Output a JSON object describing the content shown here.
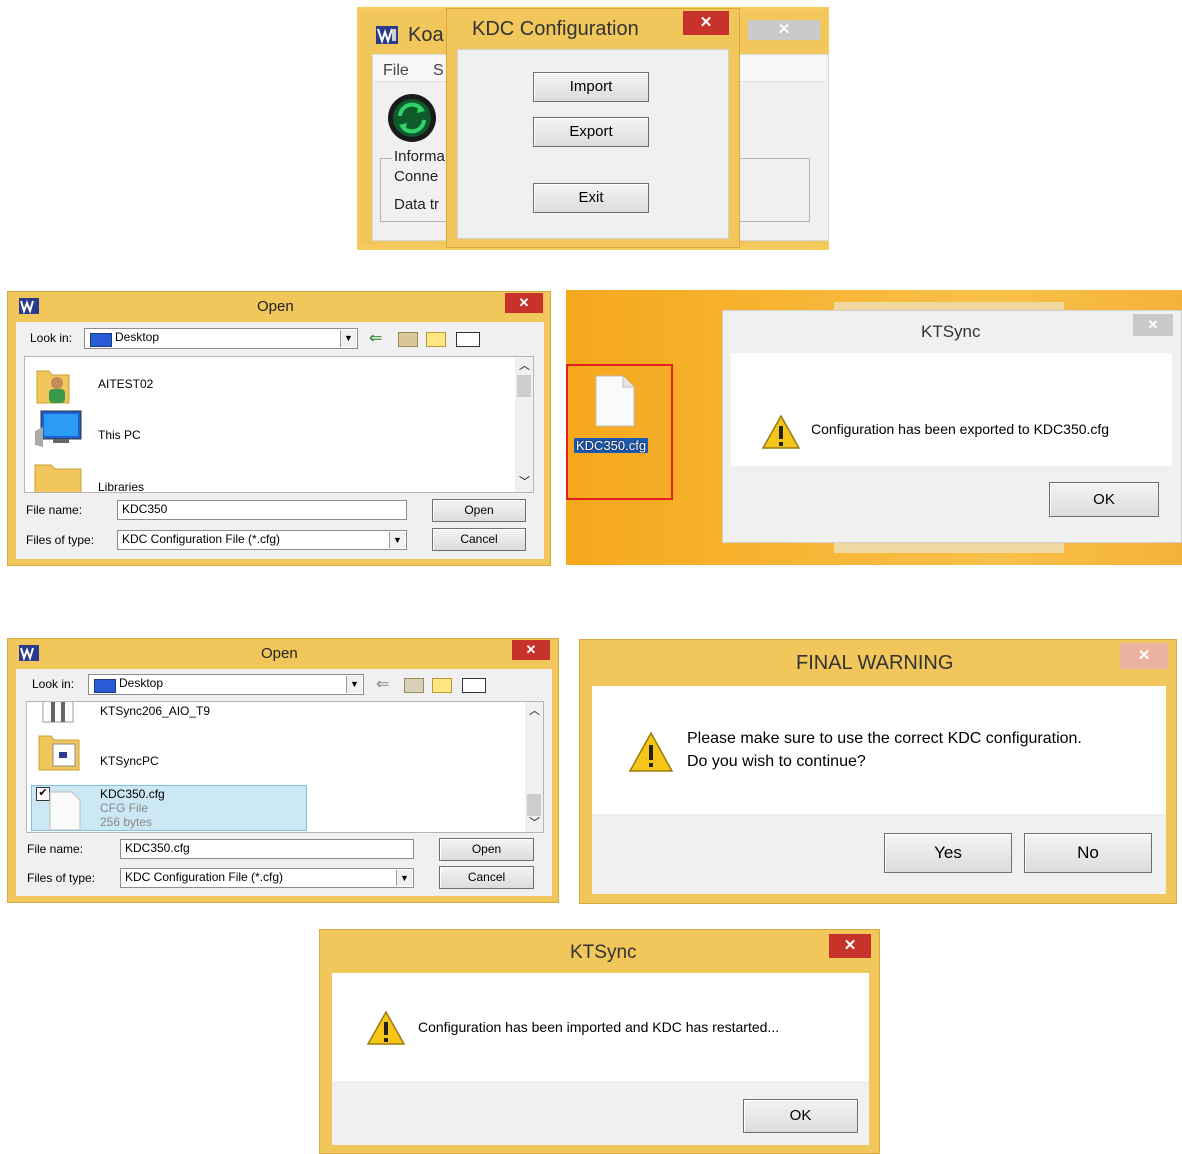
{
  "kdc_config_panel": {
    "bg_title_partial": "Koa",
    "bg_menu_file": "File",
    "bg_menu_partial": "S",
    "bg_group_info": "Informa",
    "bg_conn": "Conne",
    "bg_data": "Data tr",
    "dialog_title": "KDC Configuration",
    "close_label": "✕",
    "import_label": "Import",
    "export_label": "Export",
    "exit_label": "Exit"
  },
  "open_dialog_1": {
    "title": "Open",
    "close_label": "✕",
    "look_in_label": "Look in:",
    "look_in_value": "Desktop",
    "items": [
      "AITEST02",
      "This PC",
      "Libraries"
    ],
    "file_name_label": "File name:",
    "file_name_value": "KDC350",
    "files_of_type_label": "Files of type:",
    "files_of_type_value": "KDC Configuration File (*.cfg)",
    "open_label": "Open",
    "cancel_label": "Cancel"
  },
  "export_panel": {
    "file_icon_label": "KDC350.cfg",
    "dialog_title": "KTSync",
    "close_label": "✕",
    "message": "Configuration has been exported to KDC350.cfg",
    "ok_label": "OK"
  },
  "open_dialog_2": {
    "title": "Open",
    "close_label": "✕",
    "look_in_label": "Look in:",
    "look_in_value": "Desktop",
    "items": [
      {
        "name": "KTSync206_AIO_T9"
      },
      {
        "name": "KTSyncPC"
      },
      {
        "name": "KDC350.cfg",
        "type": "CFG File",
        "size": "256 bytes",
        "checked": true
      }
    ],
    "file_name_label": "File name:",
    "file_name_value": "KDC350.cfg",
    "files_of_type_label": "Files of type:",
    "files_of_type_value": "KDC Configuration File (*.cfg)",
    "open_label": "Open",
    "cancel_label": "Cancel"
  },
  "final_warning": {
    "title": "FINAL WARNING",
    "close_label": "✕",
    "message_line1": "Please make sure to use the correct KDC configuration.",
    "message_line2": "Do you wish to continue?",
    "yes_label": "Yes",
    "no_label": "No"
  },
  "import_done": {
    "title": "KTSync",
    "close_label": "✕",
    "message": "Configuration has been imported and KDC has restarted...",
    "ok_label": "OK"
  },
  "colors": {
    "window_frame": "#f1c65a",
    "desktop_orange": "#f5a623",
    "close_red": "#c7332a",
    "selection_blue": "#cce8f4",
    "highlight_red": "#e02020"
  },
  "icons": {
    "warning": "warning-triangle-icon",
    "folder": "folder-icon",
    "computer": "computer-icon",
    "file": "blank-file-icon",
    "app": "ktsync-app-icon",
    "sync": "sync-arrows-icon"
  }
}
